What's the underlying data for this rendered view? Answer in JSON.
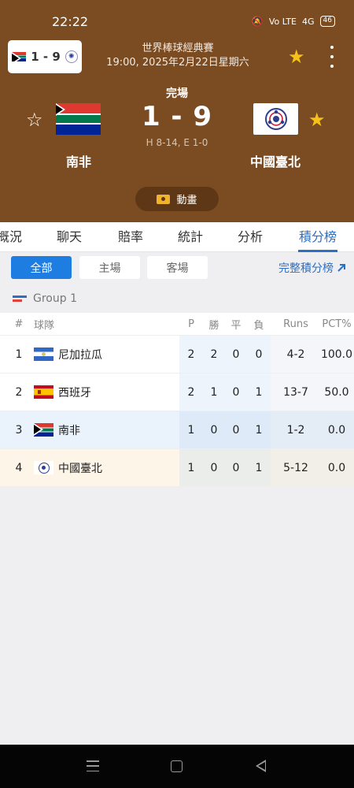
{
  "status_bar": {
    "time": "22:22",
    "battery": "46",
    "signal_label": "4G",
    "volte_label": "Vo LTE"
  },
  "mini_score": "1 - 9",
  "header": {
    "tournament": "世界棒球經典賽",
    "datetime": "19:00, 2025年2月22日星期六",
    "status": "完場",
    "score": "1 - 9",
    "detail": "H 8-14, E 1-0",
    "home_team": "南非",
    "away_team": "中國臺北",
    "animation_label": "動畫"
  },
  "tabs": [
    {
      "label": "概況"
    },
    {
      "label": "聊天"
    },
    {
      "label": "賠率"
    },
    {
      "label": "統計"
    },
    {
      "label": "分析"
    },
    {
      "label": "積分榜",
      "active": true
    }
  ],
  "filters": {
    "all": "全部",
    "home": "主場",
    "away": "客場",
    "full_standings": "完整積分榜"
  },
  "group_name": "Group 1",
  "table": {
    "headers": {
      "rank": "#",
      "team": "球隊",
      "p": "P",
      "w": "勝",
      "d": "平",
      "l": "負",
      "runs": "Runs",
      "pct": "PCT%"
    },
    "rows": [
      {
        "rank": "1",
        "team": "尼加拉瓜",
        "flag": "nicaragua-flag",
        "p": "2",
        "w": "2",
        "d": "0",
        "l": "0",
        "runs": "4-2",
        "pct": "100.0"
      },
      {
        "rank": "2",
        "team": "西班牙",
        "flag": "spain-flag",
        "p": "2",
        "w": "1",
        "d": "0",
        "l": "1",
        "runs": "13-7",
        "pct": "50.0"
      },
      {
        "rank": "3",
        "team": "南非",
        "flag": "south-africa-flag",
        "p": "1",
        "w": "0",
        "d": "0",
        "l": "1",
        "runs": "1-2",
        "pct": "0.0"
      },
      {
        "rank": "4",
        "team": "中國臺北",
        "flag": "chinese-taipei-emblem",
        "p": "1",
        "w": "0",
        "d": "0",
        "l": "1",
        "runs": "5-12",
        "pct": "0.0"
      }
    ]
  },
  "colors": {
    "header_bg": "#7b4b22",
    "accent_blue": "#1e7de0",
    "favorite_star": "#f6c21a"
  }
}
